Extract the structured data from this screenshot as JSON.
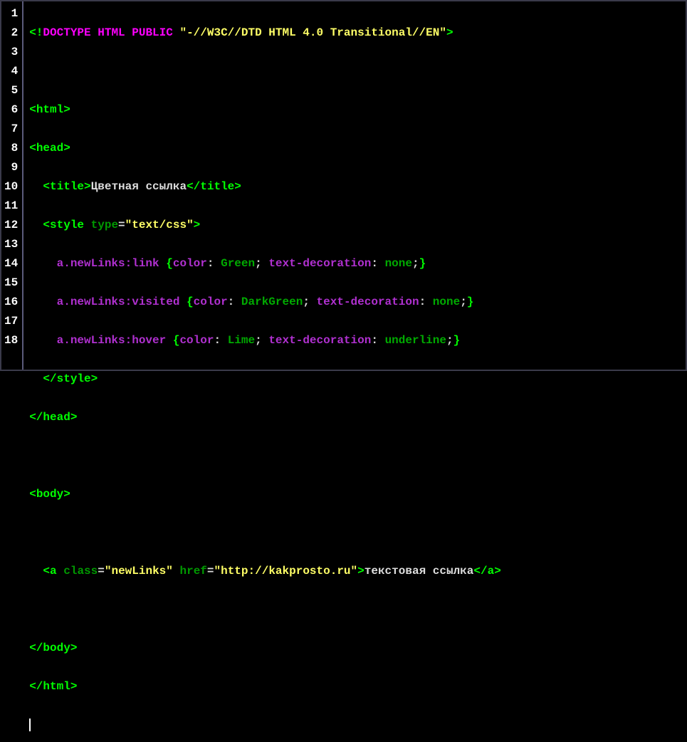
{
  "lineNumbers": [
    "1",
    "2",
    "3",
    "4",
    "5",
    "6",
    "7",
    "8",
    "9",
    "10",
    "11",
    "12",
    "13",
    "14",
    "15",
    "16",
    "17",
    "18",
    ""
  ],
  "line1": {
    "open": "<!",
    "doc": "DOCTYPE",
    "sp1": " ",
    "w1": "HTML",
    "sp2": " ",
    "w2": "PUBLIC",
    "sp3": " ",
    "str": "\"-//W3C//DTD HTML 4.0 Transitional//EN\"",
    "close": ">"
  },
  "line3": {
    "lt": "<",
    "tag": "html",
    "gt": ">"
  },
  "line4": {
    "lt": "<",
    "tag": "head",
    "gt": ">"
  },
  "line5": {
    "indent": "  ",
    "lt": "<",
    "tag": "title",
    "gt": ">",
    "text": "Цветная ссылка",
    "lt2": "</",
    "tag2": "title",
    "gt2": ">"
  },
  "line6": {
    "indent": "  ",
    "lt": "<",
    "tag": "style",
    "sp": " ",
    "attr": "type",
    "eq": "=",
    "val": "\"text/css\"",
    "gt": ">"
  },
  "css_rules": [
    {
      "indent": "    ",
      "sel": "a.newLinks:link",
      "sp": " ",
      "ob": "{",
      "p1": "color",
      "c1": ":",
      "sp1": " ",
      "v1": "Green",
      "sc1": ";",
      "sp2": " ",
      "p2": "text-decoration",
      "c2": ":",
      "sp3": " ",
      "v2": "none",
      "sc2": ";",
      "cb": "}"
    },
    {
      "indent": "    ",
      "sel": "a.newLinks:visited",
      "sp": " ",
      "ob": "{",
      "p1": "color",
      "c1": ":",
      "sp1": " ",
      "v1": "DarkGreen",
      "sc1": ";",
      "sp2": " ",
      "p2": "text-decoration",
      "c2": ":",
      "sp3": " ",
      "v2": "none",
      "sc2": ";",
      "cb": "}"
    },
    {
      "indent": "    ",
      "sel": "a.newLinks:hover",
      "sp": " ",
      "ob": "{",
      "p1": "color",
      "c1": ":",
      "sp1": " ",
      "v1": "Lime",
      "sc1": ";",
      "sp2": " ",
      "p2": "text-decoration",
      "c2": ":",
      "sp3": " ",
      "v2": "underline",
      "sc2": ";",
      "cb": "}"
    }
  ],
  "line10": {
    "indent": "  ",
    "lt": "</",
    "tag": "style",
    "gt": ">"
  },
  "line11": {
    "lt": "</",
    "tag": "head",
    "gt": ">"
  },
  "line13": {
    "lt": "<",
    "tag": "body",
    "gt": ">"
  },
  "line15": {
    "indent": "  ",
    "lt": "<",
    "tag": "a",
    "sp1": " ",
    "attr1": "class",
    "eq1": "=",
    "val1": "\"newLinks\"",
    "sp2": " ",
    "attr2": "href",
    "eq2": "=",
    "val2": "\"http://kakprosto.ru\"",
    "gt": ">",
    "text": "текстовая ссылка",
    "lt2": "</",
    "tag2": "a",
    "gt2": ">"
  },
  "line17": {
    "lt": "</",
    "tag": "body",
    "gt": ">"
  },
  "line18": {
    "lt": "</",
    "tag": "html",
    "gt": ">"
  }
}
